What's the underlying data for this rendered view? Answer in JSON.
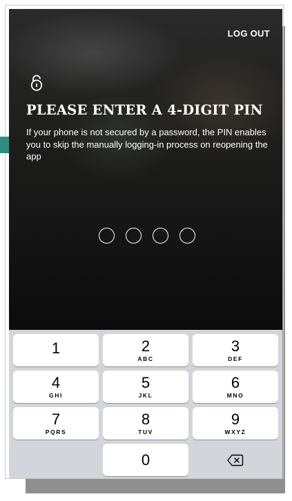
{
  "header": {
    "logout_label": "LOG OUT"
  },
  "pin_prompt": {
    "lock_icon": "lock-icon",
    "title": "PLEASE ENTER A 4-DIGIT PIN",
    "description": "If your phone is not secured by a password, the PIN enables you to skip the manually logging-in process on reopening the app",
    "dots_filled": 0,
    "dots_total": 4
  },
  "keypad": {
    "keys": [
      {
        "digit": "1",
        "letters": ""
      },
      {
        "digit": "2",
        "letters": "ABC"
      },
      {
        "digit": "3",
        "letters": "DEF"
      },
      {
        "digit": "4",
        "letters": "GHI"
      },
      {
        "digit": "5",
        "letters": "JKL"
      },
      {
        "digit": "6",
        "letters": "MNO"
      },
      {
        "digit": "7",
        "letters": "PQRS"
      },
      {
        "digit": "8",
        "letters": "TUV"
      },
      {
        "digit": "9",
        "letters": "WXYZ"
      },
      {
        "digit": "0",
        "letters": ""
      }
    ],
    "backspace_icon": "backspace-icon"
  },
  "colors": {
    "keypad_background": "#d3d5db",
    "key_background": "#ffffff",
    "accent_teal": "#2f8f7e"
  }
}
